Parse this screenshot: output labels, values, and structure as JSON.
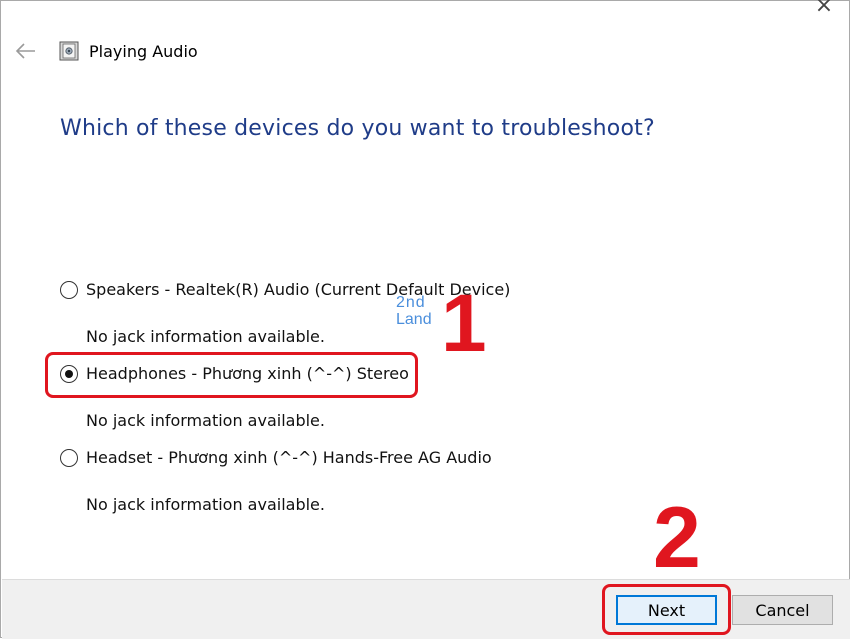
{
  "window": {
    "title": "Playing Audio",
    "close_glyph": "×"
  },
  "icons": {
    "back": "back-arrow-icon",
    "app": "troubleshooter-icon",
    "close": "close-icon"
  },
  "question": "Which of these devices do you want to troubleshoot?",
  "devices": [
    {
      "label": "Speakers - Realtek(R) Audio (Current Default Device)",
      "info": "No jack information available.",
      "selected": false
    },
    {
      "label": "Headphones - Phương xinh (^-^) Stereo",
      "info": "No jack information available.",
      "selected": true
    },
    {
      "label": "Headset - Phương xinh (^-^) Hands-Free AG Audio",
      "info": "No jack information available.",
      "selected": false
    }
  ],
  "annotations": {
    "step1": "1",
    "step2": "2",
    "color": "#e0161f"
  },
  "watermark": {
    "line1": "2nd",
    "line2": "Land",
    "color": "#2b7bd6"
  },
  "buttons": {
    "next": "Next",
    "cancel": "Cancel"
  },
  "colors": {
    "question": "#1f3c88",
    "footer_bg": "#f0f0f0",
    "next_border": "#0078d7"
  }
}
